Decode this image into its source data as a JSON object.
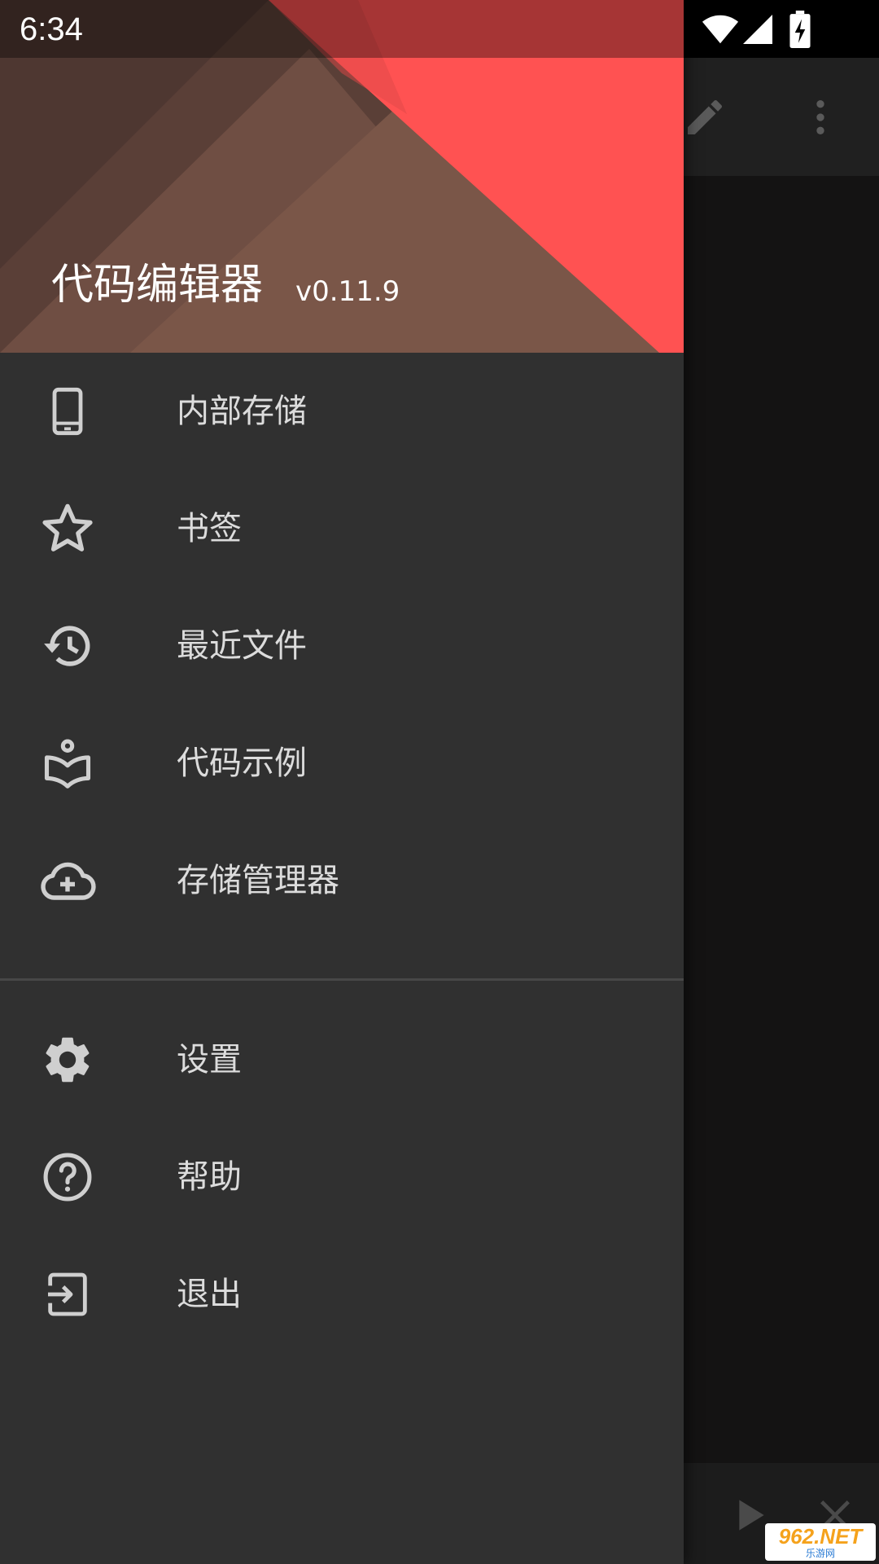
{
  "status_bar": {
    "time": "6:34",
    "icons": [
      "wifi-icon",
      "cell-signal-icon",
      "battery-charging-icon"
    ]
  },
  "drawer": {
    "header": {
      "title": "代码编辑器",
      "version": "v0.11.9"
    },
    "items": [
      {
        "label": "内部存储",
        "icon": "phone-icon"
      },
      {
        "label": "书签",
        "icon": "star-outline-icon"
      },
      {
        "label": "最近文件",
        "icon": "history-icon"
      },
      {
        "label": "代码示例",
        "icon": "book-reader-icon"
      },
      {
        "label": "存储管理器",
        "icon": "cloud-add-icon"
      }
    ],
    "secondary_items": [
      {
        "label": "设置",
        "icon": "gear-icon"
      },
      {
        "label": "帮助",
        "icon": "help-circle-icon"
      },
      {
        "label": "退出",
        "icon": "exit-icon"
      }
    ]
  },
  "background_app": {
    "toolbar_icons": [
      "edit-icon",
      "more-vert-icon"
    ],
    "bottom_icons": [
      "play-icon",
      "close-icon"
    ]
  },
  "watermark": {
    "text": "962.NET",
    "subtext": "乐游网"
  },
  "colors": {
    "drawer_bg": "#303030",
    "header_brown": "#7a5648",
    "header_red": "#ff5252",
    "text": "#dcdcdc",
    "icon": "#cfcfcf"
  }
}
